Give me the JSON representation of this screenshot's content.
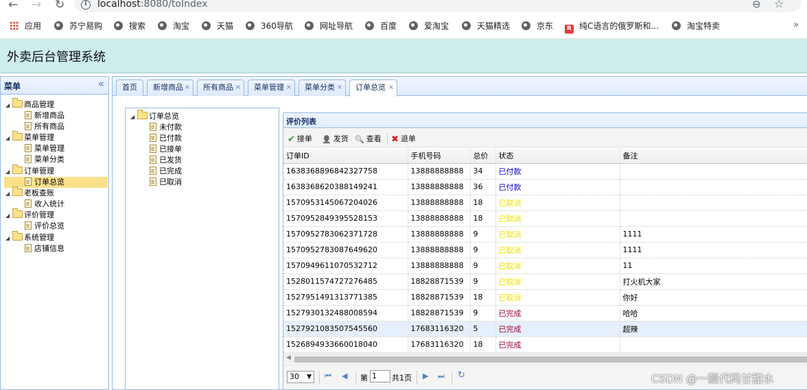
{
  "browser": {
    "url_host": "localhost",
    "url_path": ":8080/toIndex",
    "bookmarks": [
      "应用",
      "苏宁易购",
      "搜索",
      "淘宝",
      "天猫",
      "360导航",
      "网址导航",
      "百度",
      "爱淘宝",
      "天猫精选",
      "京东",
      "纯C语言的俄罗斯和...",
      "淘宝特卖"
    ],
    "more": "»"
  },
  "app": {
    "title": "外卖后台管理系统"
  },
  "menu": {
    "title": "菜单",
    "collapse": "«",
    "groups": [
      {
        "label": "商品管理",
        "items": [
          "新增商品",
          "所有商品"
        ]
      },
      {
        "label": "菜单管理",
        "items": [
          "菜单管理",
          "菜单分类"
        ]
      },
      {
        "label": "订单管理",
        "items": [
          "订单总览"
        ]
      },
      {
        "label": "老板查账",
        "items": [
          "收入统计"
        ]
      },
      {
        "label": "评价管理",
        "items": [
          "评价总览"
        ]
      },
      {
        "label": "系统管理",
        "items": [
          "店铺信息"
        ]
      }
    ],
    "selected": "订单总览"
  },
  "tabs": [
    {
      "label": "首页",
      "closable": false
    },
    {
      "label": "新增商品",
      "closable": true
    },
    {
      "label": "所有商品",
      "closable": true
    },
    {
      "label": "菜单管理",
      "closable": true
    },
    {
      "label": "菜单分类",
      "closable": true
    },
    {
      "label": "订单总览",
      "closable": true,
      "active": true
    }
  ],
  "order_tree": {
    "root": "订单总览",
    "children": [
      "未付款",
      "已付款",
      "已接单",
      "已发货",
      "已完成",
      "已取消"
    ]
  },
  "grid": {
    "title": "评价列表",
    "toolbar": [
      {
        "label": "接单",
        "icon": "check-icon",
        "color": "#2e9b2e"
      },
      {
        "label": "发货",
        "icon": "person-icon",
        "color": "#333333"
      },
      {
        "label": "查看",
        "icon": "magnifier-icon",
        "color": "#4a7fc1"
      },
      {
        "label": "退单",
        "icon": "red-x-icon",
        "color": "#e02020"
      }
    ],
    "columns": [
      "订单ID",
      "手机号码",
      "总价",
      "状态",
      "备注"
    ],
    "rows": [
      [
        "1638368896842327758",
        "13888888888",
        "34",
        "已付款",
        ""
      ],
      [
        "1638368620388149241",
        "13888888888",
        "36",
        "已付款",
        ""
      ],
      [
        "1570953145067204026",
        "13888888888",
        "18",
        "已取消",
        ""
      ],
      [
        "1570952849395528153",
        "13888888888",
        "18",
        "已取消",
        ""
      ],
      [
        "1570952783062371728",
        "13888888888",
        "9",
        "已取消",
        "1111"
      ],
      [
        "1570952783087649620",
        "13888888888",
        "9",
        "已取消",
        "1111"
      ],
      [
        "1570949611070532712",
        "13888888888",
        "9",
        "已取消",
        "11"
      ],
      [
        "1528011574727276485",
        "18828871539",
        "9",
        "已取消",
        "打火机大家"
      ],
      [
        "1527951491313771385",
        "18828871539",
        "18",
        "已取消",
        "你好"
      ],
      [
        "1527930132488008594",
        "18828871539",
        "9",
        "已完成",
        "哈哈"
      ],
      [
        "1527921083507545560",
        "17683116320",
        "5",
        "已完成",
        "超辣"
      ],
      [
        "1526894933660018040",
        "17683116320",
        "18",
        "已完成",
        ""
      ]
    ],
    "highlighted_row": 10,
    "status_colors": {
      "已付款": "#0000cc",
      "已取消": "#f0e000",
      "已完成": "#990033"
    }
  },
  "pager": {
    "page_size": "30",
    "page_label": "第",
    "page_value": "1",
    "total_label": "共1页"
  },
  "watermark": "CSDN @一瓢代码甘甜水"
}
